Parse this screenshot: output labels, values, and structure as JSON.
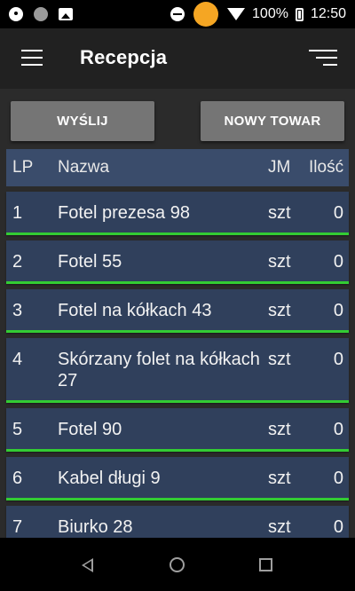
{
  "status_bar": {
    "battery_percent": "100%",
    "time": "12:50"
  },
  "app_bar": {
    "title": "Recepcja"
  },
  "actions": {
    "send_label": "WYŚLIJ",
    "new_item_label": "NOWY TOWAR"
  },
  "table": {
    "headers": {
      "lp": "LP",
      "name": "Nazwa",
      "unit": "JM",
      "qty": "Ilość"
    },
    "rows": [
      {
        "lp": "1",
        "name": "Fotel prezesa 98",
        "unit": "szt",
        "qty": "0"
      },
      {
        "lp": "2",
        "name": "Fotel 55",
        "unit": "szt",
        "qty": "0"
      },
      {
        "lp": "3",
        "name": "Fotel na kółkach 43",
        "unit": "szt",
        "qty": "0"
      },
      {
        "lp": "4",
        "name": "Skórzany folet na kółkach 27",
        "unit": "szt",
        "qty": "0"
      },
      {
        "lp": "5",
        "name": "Fotel 90",
        "unit": "szt",
        "qty": "0"
      },
      {
        "lp": "6",
        "name": "Kabel długi 9",
        "unit": "szt",
        "qty": "0"
      },
      {
        "lp": "7",
        "name": "Biurko 28",
        "unit": "szt",
        "qty": "0"
      }
    ]
  },
  "colors": {
    "accent_line": "#33cc33",
    "row_bg": "#30405c",
    "header_bg": "#3a4c6b",
    "button_bg": "#757575"
  }
}
